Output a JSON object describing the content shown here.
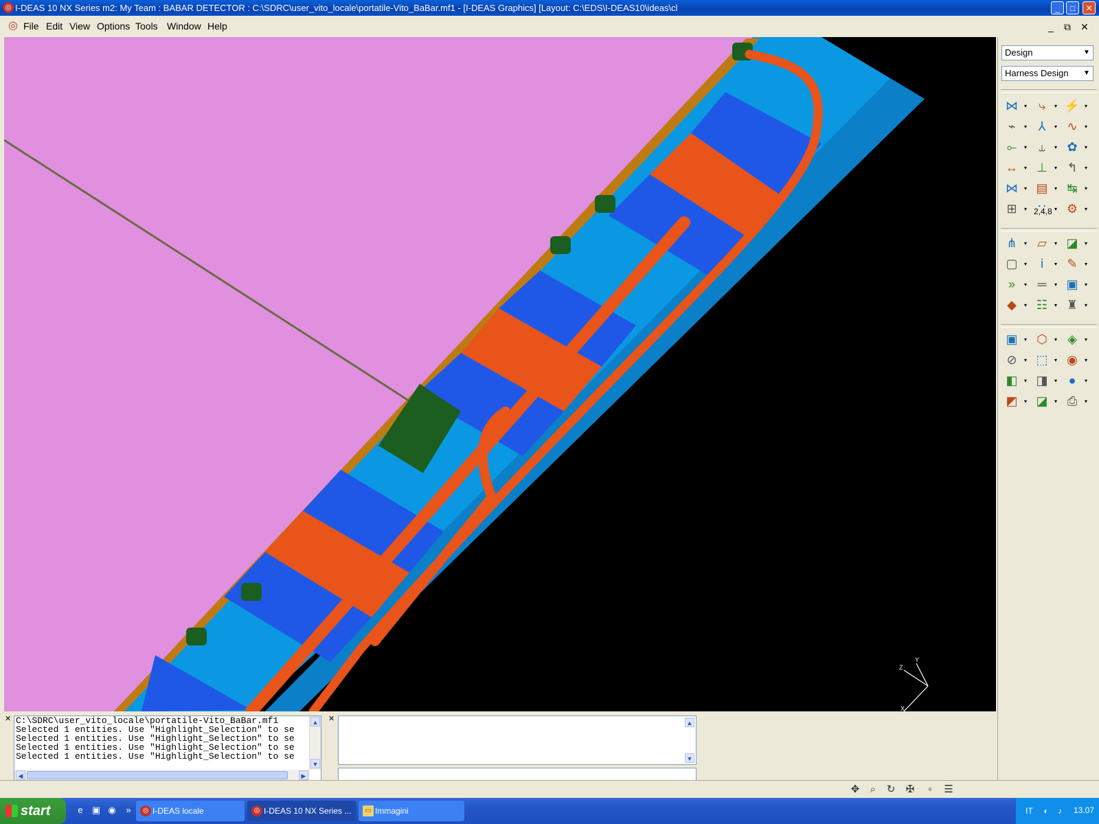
{
  "window": {
    "title": "I-DEAS 10 NX Series m2:     My Team : BABAR DETECTOR : C:\\SDRC\\user_vito_locale\\portatile-Vito_BaBar.mf1 - [I-DEAS Graphics]   [Layout: C:\\EDS\\I-DEAS10\\ideas\\cl",
    "minimize": "_",
    "maximize": "□",
    "close": "✕"
  },
  "menu": {
    "items": [
      "File",
      "Edit",
      "View",
      "Options",
      "Tools",
      "Window",
      "Help"
    ],
    "mdi_minimize": "_",
    "mdi_restore": "⧉",
    "mdi_close": "✕"
  },
  "viewport": {
    "background": "#000000",
    "plane_color": "#e090de",
    "triad_labels": [
      "Z",
      "Y",
      "X"
    ]
  },
  "panel": {
    "application": "Design",
    "task": "Harness Design",
    "label_248": "2,4,8"
  },
  "icons": {
    "toolbar_1": [
      "route-wire-icon",
      "route-path-icon",
      "connector-icon",
      "cable-icon",
      "branch-icon",
      "harness-icon",
      "split-icon",
      "wire-icon",
      "clip-icon",
      "dimension-icon",
      "measure-icon",
      "bend-icon",
      "node-icon",
      "bom-icon",
      "length-icon",
      "part-icon",
      "gauge-icon",
      "bundle-icon"
    ],
    "toolbar_2": [
      "tree-icon",
      "sketch-icon",
      "display-icon",
      "frame-icon",
      "info-icon",
      "paint-icon",
      "arrows-icon",
      "ruler-icon",
      "cube-icon",
      "eraser-icon",
      "list-icon",
      "person-icon"
    ],
    "toolbar_3": [
      "view-monitor-icon",
      "view-wireframe-icon",
      "view-shaded-icon",
      "zoom-icon",
      "zoom-box-icon",
      "eye-icon",
      "view-zx-icon",
      "view-xz-icon",
      "sphere-icon",
      "view-yx-icon",
      "view-yz-icon",
      "print-icon"
    ]
  },
  "log": {
    "lines": [
      "C:\\SDRC\\user_vito_locale\\portatile-Vito_BaBar.mf1",
      "Selected 1 entities.  Use \"Highlight_Selection\" to se",
      "Selected 1 entities.  Use \"Highlight_Selection\" to se",
      "Selected 1 entities.  Use \"Highlight_Selection\" to se",
      "Selected 1 entities.  Use \"Highlight_Selection\" to se"
    ]
  },
  "prompt": {
    "value": ""
  },
  "status_icons": [
    "pan-icon",
    "zoom-icon",
    "rotate-icon",
    "view-icon",
    "window-icon",
    "menu-icon"
  ],
  "taskbar": {
    "start": "start",
    "tasks": [
      {
        "label": "I-DEAS locale",
        "icon": "ideas-icon"
      },
      {
        "label": "I-DEAS 10 NX Series ...",
        "icon": "ideas-icon"
      },
      {
        "label": "Immagini",
        "icon": "folder-icon"
      }
    ],
    "language": "IT",
    "clock": "13.07"
  },
  "colors": {
    "accent": "#0a50c8",
    "orange": "#e8541a",
    "blue": "#1f58e6",
    "cyan": "#0a98e2",
    "green": "#1b5e20"
  }
}
